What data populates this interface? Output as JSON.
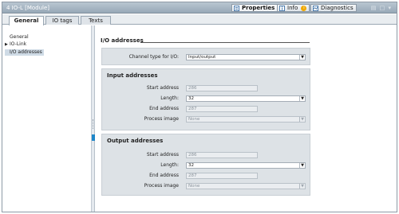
{
  "window": {
    "title": "4 IO-L [Module]",
    "buttons": [
      {
        "label": "Properties",
        "icon": "properties-icon",
        "active": true
      },
      {
        "label": "Info",
        "icon": "info-icon",
        "badge": "i"
      },
      {
        "label": "Diagnostics",
        "icon": "diagnostics-icon"
      }
    ],
    "controls": "▤ □ ▾"
  },
  "tabs": [
    "General",
    "IO tags",
    "Texts"
  ],
  "nav": {
    "items": [
      {
        "label": "General",
        "expandable": false
      },
      {
        "label": "IO-Link",
        "expandable": true,
        "arrow": "▶"
      },
      {
        "label": "I/O addresses",
        "expandable": false,
        "selected": true
      }
    ]
  },
  "section": {
    "title": "I/O addresses"
  },
  "channel": {
    "label": "Channel type for I/O:",
    "value": "Input/output"
  },
  "input": {
    "title": "Input addresses",
    "start_label": "Start address",
    "start_value": "286",
    "length_label": "Length:",
    "length_value": "32",
    "end_label": "End address",
    "end_value": "287",
    "process_label": "Process image",
    "process_value": "None"
  },
  "output": {
    "title": "Output addresses",
    "start_label": "Start address",
    "start_value": "286",
    "length_label": "Length:",
    "length_value": "32",
    "end_label": "End address",
    "end_value": "287",
    "process_label": "Process image",
    "process_value": "None"
  },
  "colors": {
    "titlebar": "#a8b8c6",
    "panel": "#dde2e6",
    "selection": "#cfdbe6",
    "marker": "#1e86c8"
  }
}
